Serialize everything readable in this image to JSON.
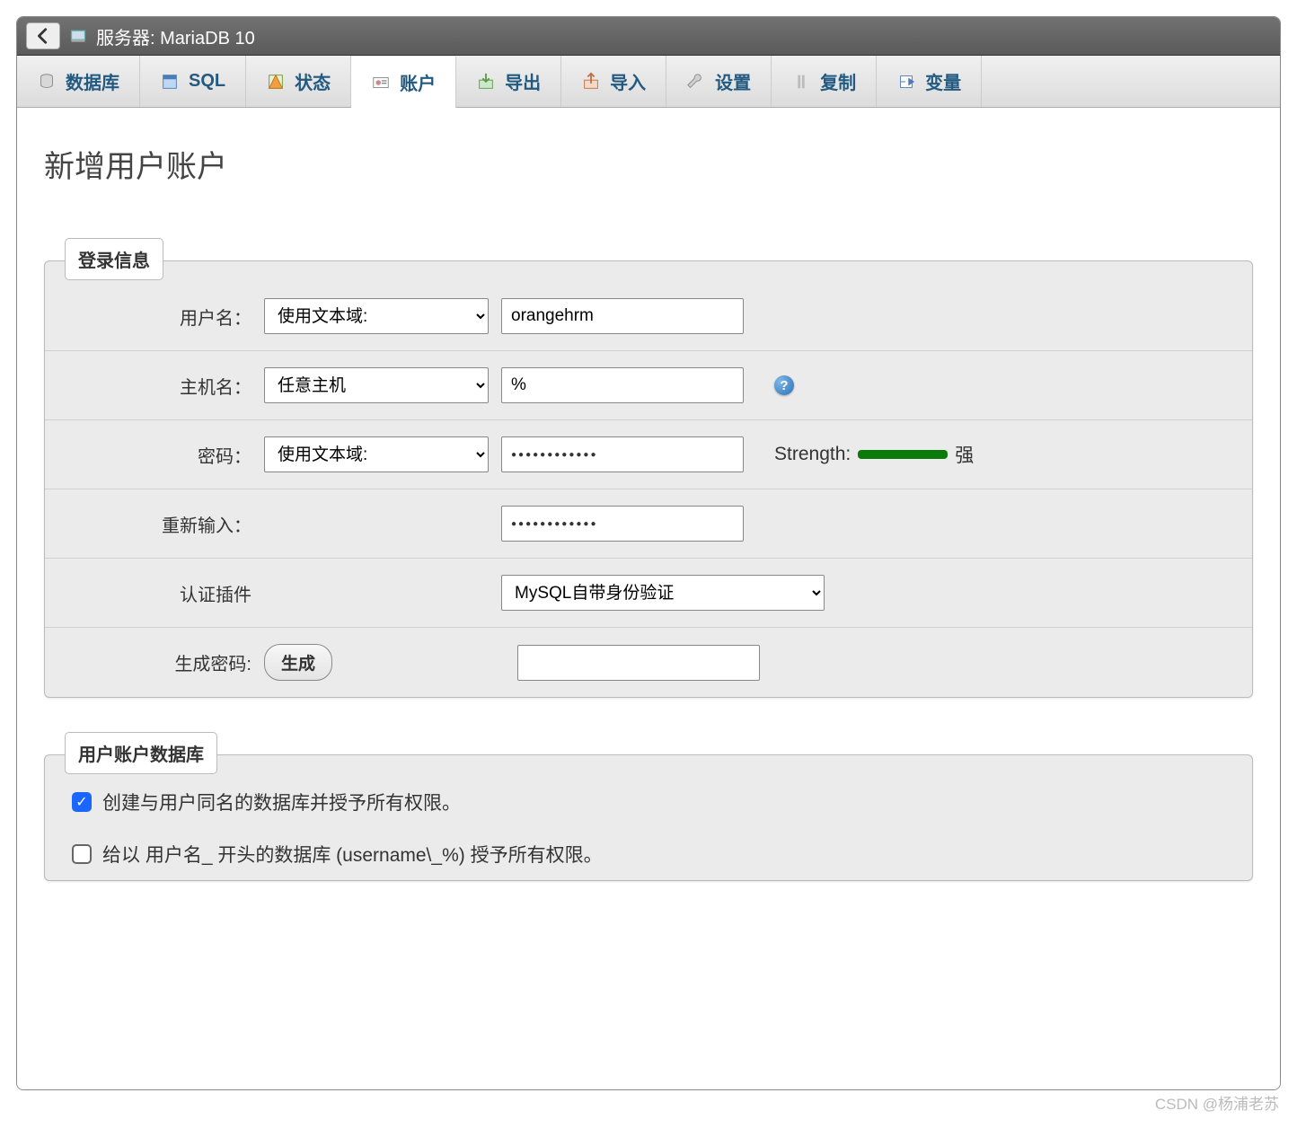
{
  "titlebar": {
    "label": "服务器: MariaDB 10"
  },
  "tabs": [
    {
      "label": "数据库"
    },
    {
      "label": "SQL"
    },
    {
      "label": "状态"
    },
    {
      "label": "账户"
    },
    {
      "label": "导出"
    },
    {
      "label": "导入"
    },
    {
      "label": "设置"
    },
    {
      "label": "复制"
    },
    {
      "label": "变量"
    }
  ],
  "page_title": "新增用户账户",
  "fieldset_login": {
    "legend": "登录信息",
    "username": {
      "label": "用户名：",
      "select": "使用文本域:",
      "value": "orangehrm"
    },
    "host": {
      "label": "主机名：",
      "select": "任意主机",
      "value": "%"
    },
    "password": {
      "label": "密码：",
      "select": "使用文本域:",
      "value": "●●●●●●●●●●●●",
      "strength_label": "Strength:",
      "strength_text": "强"
    },
    "retype": {
      "label": "重新输入：",
      "value": "●●●●●●●●●●●●"
    },
    "auth": {
      "label": "认证插件",
      "value": "MySQL自带身份验证"
    },
    "generate": {
      "label": "生成密码:",
      "button": "生成",
      "value": ""
    }
  },
  "fieldset_db": {
    "legend": "用户账户数据库",
    "opt1": {
      "checked": true,
      "label": "创建与用户同名的数据库并授予所有权限。"
    },
    "opt2": {
      "checked": false,
      "label": "给以 用户名_ 开头的数据库 (username\\_%) 授予所有权限。"
    }
  },
  "watermark": "CSDN @杨浦老苏"
}
